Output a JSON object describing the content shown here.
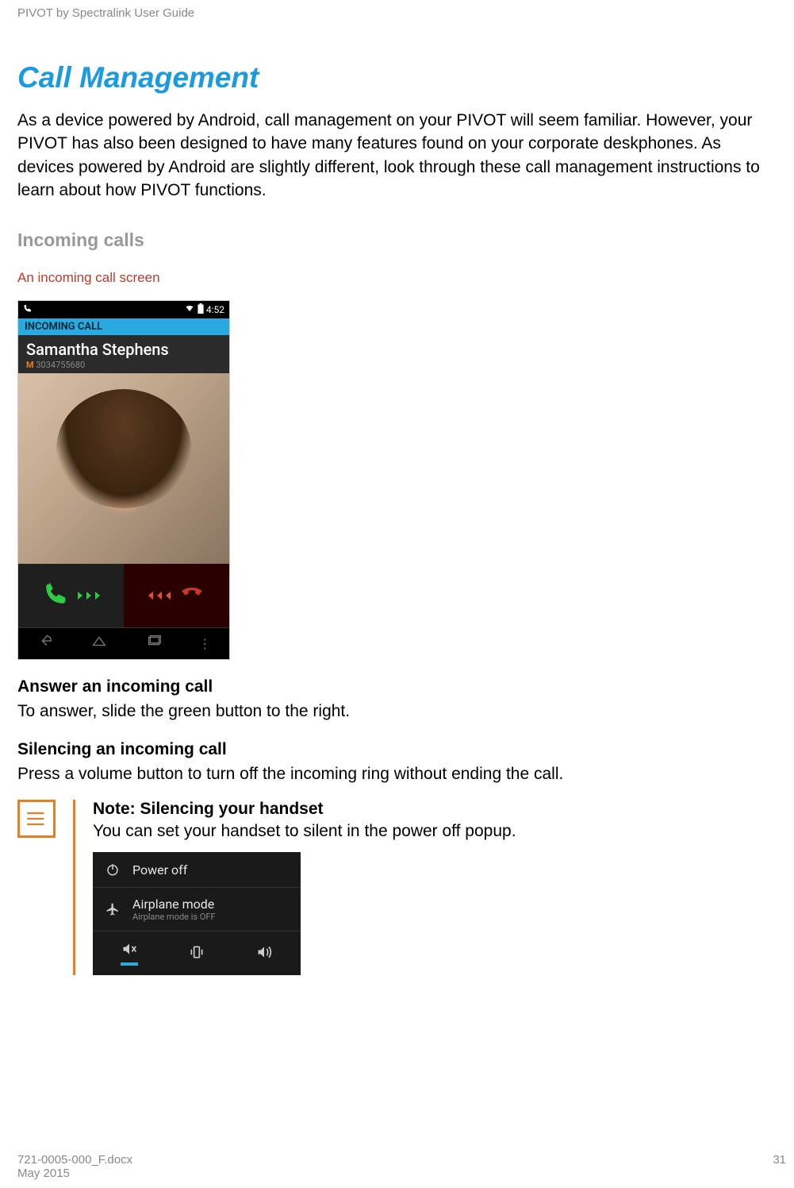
{
  "header": {
    "guide": "PIVOT by Spectralink User Guide"
  },
  "title": "Call Management",
  "intro": "As a device powered by Android, call management on your PIVOT will seem familiar. However, your PIVOT has also been designed to have many features found on your corporate deskphones. As devices powered by Android are slightly different, look through these call management instructions to learn about how PIVOT functions.",
  "subheading": "Incoming calls",
  "caption": "An incoming call screen",
  "phone": {
    "time": "4:52",
    "banner": "INCOMING CALL",
    "caller": "Samantha Stephens",
    "type": "M",
    "number": "3034755680"
  },
  "answer": {
    "heading": "Answer an incoming call",
    "text": "To answer, slide the green button to the right."
  },
  "silence": {
    "heading": "Silencing an incoming call",
    "text": "Press a volume button to turn off the incoming ring without ending the call."
  },
  "note": {
    "title": "Note: Silencing your handset",
    "text": "You can set your handset to silent in the power off popup.",
    "popup": {
      "poweroff": "Power off",
      "airplane": "Airplane mode",
      "airplane_sub": "Airplane mode is OFF"
    }
  },
  "footer": {
    "doc": "721-0005-000_F.docx",
    "date": "May 2015",
    "page": "31"
  }
}
